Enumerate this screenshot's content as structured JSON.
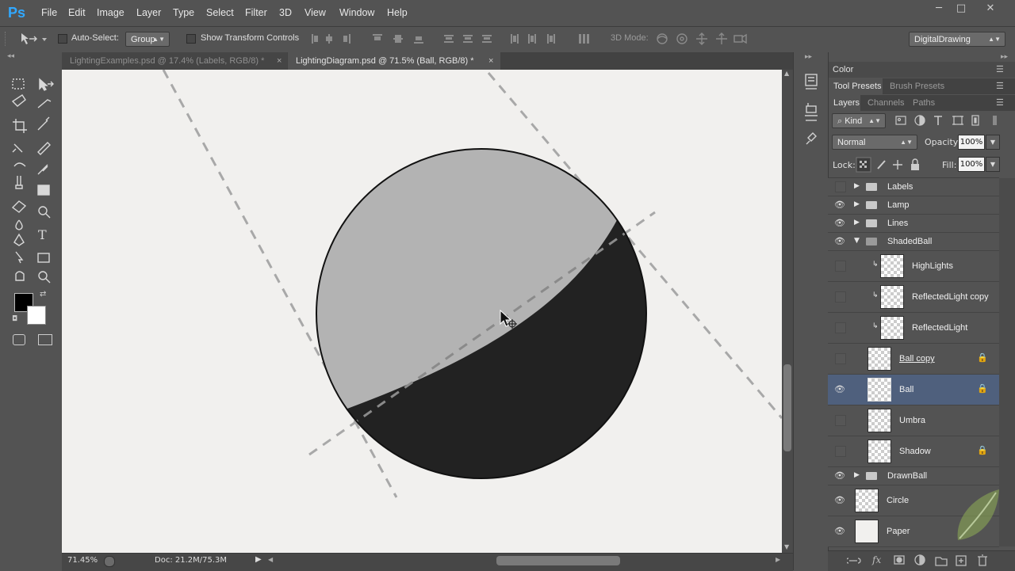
{
  "app": {
    "logo": "Ps"
  },
  "menu": [
    "File",
    "Edit",
    "Image",
    "Layer",
    "Type",
    "Select",
    "Filter",
    "3D",
    "View",
    "Window",
    "Help"
  ],
  "window_controls": {
    "minimize": "─",
    "maximize": "□",
    "close": "✕"
  },
  "options": {
    "auto_select_label": "Auto-Select:",
    "auto_select_value": "Group",
    "show_transform_label": "Show Transform Controls",
    "mode_3d_label": "3D Mode:",
    "workspace": "DigitalDrawing"
  },
  "tabs": [
    {
      "label": "LightingExamples.psd @ 17.4% (Labels, RGB/8) *",
      "close": "×",
      "active": false
    },
    {
      "label": "LightingDiagram.psd @ 71.5% (Ball, RGB/8) *",
      "close": "×",
      "active": true
    }
  ],
  "status": {
    "zoom": "71.45%",
    "doc": "Doc: 21.2M/75.3M"
  },
  "panels": {
    "color_tab": "Color",
    "tool_presets_tab": "Tool Presets",
    "brush_presets_tab": "Brush Presets",
    "layers_tab": "Layers",
    "channels_tab": "Channels",
    "paths_tab": "Paths",
    "filter_kind": "Kind",
    "blend_mode": "Normal",
    "opacity_label": "Opacity:",
    "opacity_value": "100%",
    "lock_label": "Lock:",
    "fill_label": "Fill:",
    "fill_value": "100%"
  },
  "layers": [
    {
      "name": "Labels",
      "type": "group",
      "visible": false,
      "expanded": false
    },
    {
      "name": "Lamp",
      "type": "group",
      "visible": true,
      "expanded": false
    },
    {
      "name": "Lines",
      "type": "group",
      "visible": true,
      "expanded": false
    },
    {
      "name": "ShadedBall",
      "type": "group",
      "visible": true,
      "expanded": true
    },
    {
      "name": "HighLights",
      "type": "layer",
      "visible": false,
      "clipped": true
    },
    {
      "name": "ReflectedLight copy",
      "type": "layer",
      "visible": false,
      "clipped": true
    },
    {
      "name": "ReflectedLight",
      "type": "layer",
      "visible": false,
      "clipped": true
    },
    {
      "name": "Ball copy",
      "type": "layer",
      "visible": false,
      "locked": true
    },
    {
      "name": "Ball",
      "type": "layer",
      "visible": true,
      "locked": true,
      "selected": true
    },
    {
      "name": "Umbra",
      "type": "layer",
      "visible": false
    },
    {
      "name": "Shadow",
      "type": "layer",
      "visible": false,
      "locked": true
    },
    {
      "name": "DrawnBall",
      "type": "group",
      "visible": true,
      "expanded": false
    },
    {
      "name": "Circle",
      "type": "layer",
      "visible": true
    },
    {
      "name": "Paper",
      "type": "layer",
      "visible": true
    }
  ],
  "colors": {
    "selected_row": "#4f607d",
    "canvas_bg": "#f1f0ee",
    "ball_light": "#b2b2b2",
    "ball_dark": "#222222",
    "dash": "#a5a5a5",
    "ps_blue": "#31a8ff"
  }
}
